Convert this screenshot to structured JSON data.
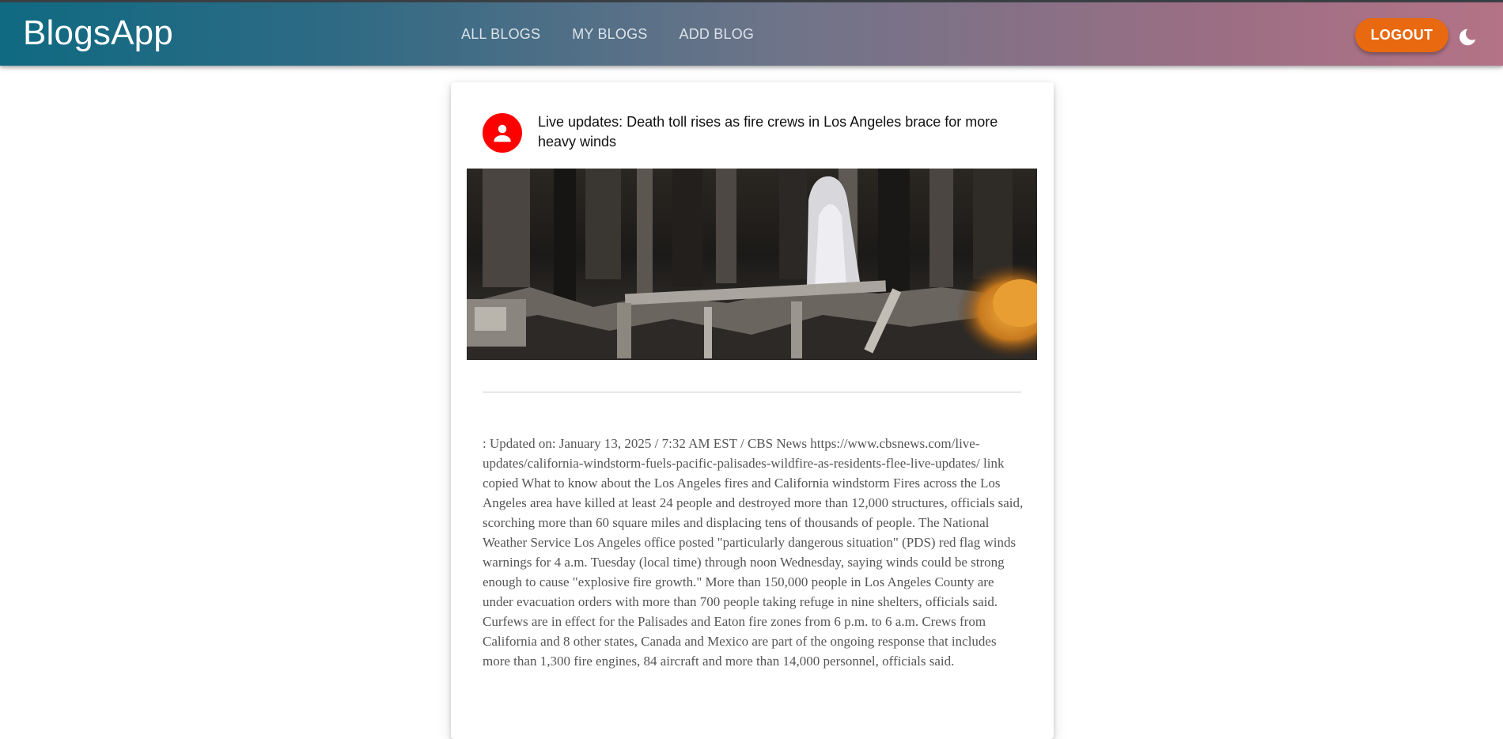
{
  "header": {
    "brand": "BlogsApp",
    "nav": [
      "ALL BLOGS",
      "MY BLOGS",
      "ADD BLOG"
    ],
    "logout_label": "LOGOUT",
    "theme_icon": "moon-icon"
  },
  "post": {
    "avatar_icon": "person-icon",
    "title": "Live updates: Death toll rises as fire crews in Los Angeles brace for more heavy winds",
    "image_description": "burned debris",
    "body": ": Updated on: January 13, 2025 / 7:32 AM EST / CBS News https://www.cbsnews.com/live-updates/california-windstorm-fuels-pacific-palisades-wildfire-as-residents-flee-live-updates/ link copied What to know about the Los Angeles fires and California windstorm Fires across the Los Angeles area have killed at least 24 people and destroyed more than 12,000 structures, officials said, scorching more than 60 square miles and displacing tens of thousands of people. The National Weather Service Los Angeles office posted \"particularly dangerous situation\" (PDS) red flag winds warnings for 4 a.m. Tuesday (local time) through noon Wednesday, saying winds could be strong enough to cause \"explosive fire growth.\" More than 150,000 people in Los Angeles County are under evacuation orders with more than 700 people taking refuge in nine shelters, officials said. Curfews are in effect for the Palisades and Eaton fire zones from 6 p.m. to 6 a.m. Crews from California and 8 other states, Canada and Mexico are part of the ongoing response that includes more than 1,300 fire engines, 84 aircraft and more than 14,000 personnel, officials said."
  },
  "colors": {
    "accent": "#e8690f",
    "avatar": "#ff0000",
    "header_start": "#0f6a82",
    "header_end": "#b47386"
  }
}
